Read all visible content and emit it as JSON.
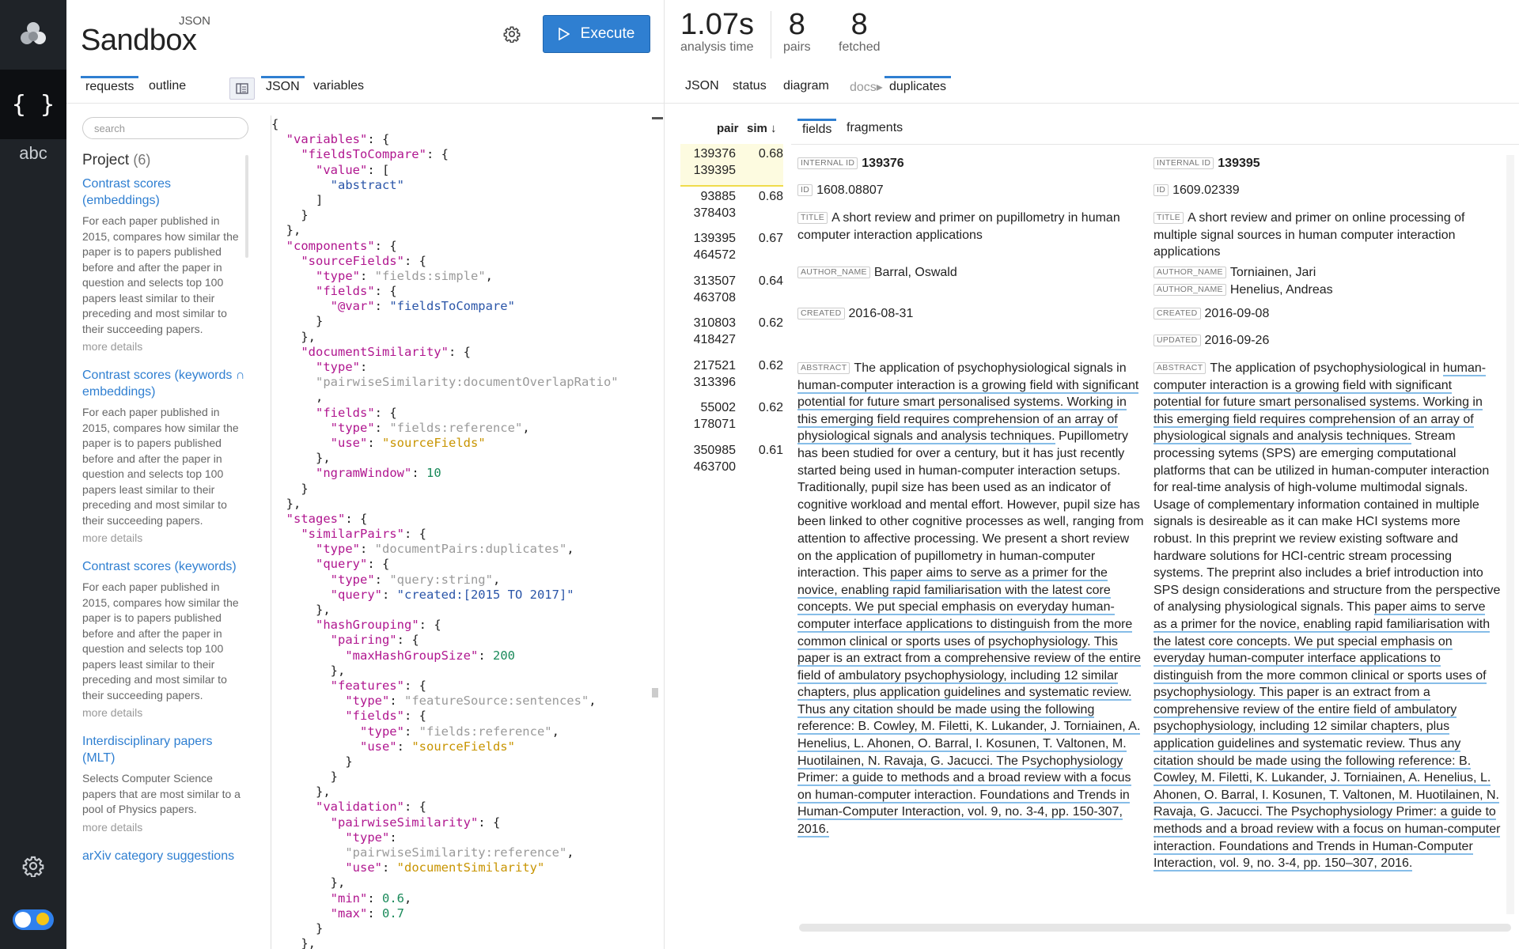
{
  "brand": {
    "sup": "JSON",
    "main": "Sandbox"
  },
  "toolbar": {
    "execute_label": "Execute"
  },
  "left_tabs": {
    "requests": "requests",
    "outline": "outline",
    "json": "JSON",
    "variables": "variables"
  },
  "search": {
    "placeholder": "search"
  },
  "project": {
    "label": "Project",
    "count": "(6)",
    "items": [
      {
        "title": "Contrast scores (embeddings)",
        "desc": "For each paper published in 2015, compares how similar the paper is to papers published before and after the paper in question and selects top 100 papers least similar to their preceding and most similar to their succeeding papers.",
        "more": "more details"
      },
      {
        "title": "Contrast scores (keywords ∩ embeddings)",
        "desc": "For each paper published in 2015, compares how similar the paper is to papers published before and after the paper in question and selects top 100 papers least similar to their preceding and most similar to their succeeding papers.",
        "more": "more details"
      },
      {
        "title": "Contrast scores (keywords)",
        "desc": "For each paper published in 2015, compares how similar the paper is to papers published before and after the paper in question and selects top 100 papers least similar to their preceding and most similar to their succeeding papers.",
        "more": "more details"
      },
      {
        "title": "Interdisciplinary papers (MLT)",
        "desc": "Selects Computer Science papers that are most similar to a pool of Physics papers.",
        "more": "more details"
      },
      {
        "title": "arXiv category suggestions",
        "desc": "",
        "more": ""
      }
    ]
  },
  "editor": {
    "lines": [
      [
        [
          "p",
          "{"
        ]
      ],
      [
        [
          "p",
          "  "
        ],
        [
          "k",
          "\"variables\""
        ],
        [
          "p",
          ": {"
        ]
      ],
      [
        [
          "p",
          "    "
        ],
        [
          "k",
          "\"fieldsToCompare\""
        ],
        [
          "p",
          ": {"
        ]
      ],
      [
        [
          "p",
          "      "
        ],
        [
          "k",
          "\"value\""
        ],
        [
          "p",
          ": ["
        ]
      ],
      [
        [
          "p",
          "        "
        ],
        [
          "sv",
          "\"abstract\""
        ]
      ],
      [
        [
          "p",
          "      ]"
        ]
      ],
      [
        [
          "p",
          "    }"
        ]
      ],
      [
        [
          "p",
          "  },"
        ]
      ],
      [
        [
          "p",
          "  "
        ],
        [
          "k",
          "\"components\""
        ],
        [
          "p",
          ": {"
        ]
      ],
      [
        [
          "p",
          "    "
        ],
        [
          "k",
          "\"sourceFields\""
        ],
        [
          "p",
          ": {"
        ]
      ],
      [
        [
          "p",
          "      "
        ],
        [
          "k",
          "\"type\""
        ],
        [
          "p",
          ": "
        ],
        [
          "st",
          "\"fields:simple\""
        ],
        [
          "p",
          ","
        ]
      ],
      [
        [
          "p",
          "      "
        ],
        [
          "k",
          "\"fields\""
        ],
        [
          "p",
          ": {"
        ]
      ],
      [
        [
          "p",
          "        "
        ],
        [
          "k",
          "\"@var\""
        ],
        [
          "p",
          ": "
        ],
        [
          "sv",
          "\"fieldsToCompare\""
        ]
      ],
      [
        [
          "p",
          "      }"
        ]
      ],
      [
        [
          "p",
          "    },"
        ]
      ],
      [
        [
          "p",
          "    "
        ],
        [
          "k",
          "\"documentSimilarity\""
        ],
        [
          "p",
          ": {"
        ]
      ],
      [
        [
          "p",
          "      "
        ],
        [
          "k",
          "\"type\""
        ],
        [
          "p",
          ":"
        ]
      ],
      [
        [
          "p",
          "      "
        ],
        [
          "st",
          "\"pairwiseSimilarity:documentOverlapRatio\""
        ]
      ],
      [
        [
          "p",
          "      ,"
        ]
      ],
      [
        [
          "p",
          "      "
        ],
        [
          "k",
          "\"fields\""
        ],
        [
          "p",
          ": {"
        ]
      ],
      [
        [
          "p",
          "        "
        ],
        [
          "k",
          "\"type\""
        ],
        [
          "p",
          ": "
        ],
        [
          "st",
          "\"fields:reference\""
        ],
        [
          "p",
          ","
        ]
      ],
      [
        [
          "p",
          "        "
        ],
        [
          "k",
          "\"use\""
        ],
        [
          "p",
          ": "
        ],
        [
          "su",
          "\"sourceFields\""
        ]
      ],
      [
        [
          "p",
          "      },"
        ]
      ],
      [
        [
          "p",
          "      "
        ],
        [
          "k",
          "\"ngramWindow\""
        ],
        [
          "p",
          ": "
        ],
        [
          "n",
          "10"
        ]
      ],
      [
        [
          "p",
          "    }"
        ]
      ],
      [
        [
          "p",
          "  },"
        ]
      ],
      [
        [
          "p",
          "  "
        ],
        [
          "k",
          "\"stages\""
        ],
        [
          "p",
          ": {"
        ]
      ],
      [
        [
          "p",
          "    "
        ],
        [
          "k",
          "\"similarPairs\""
        ],
        [
          "p",
          ": {"
        ]
      ],
      [
        [
          "p",
          "      "
        ],
        [
          "k",
          "\"type\""
        ],
        [
          "p",
          ": "
        ],
        [
          "st",
          "\"documentPairs:duplicates\""
        ],
        [
          "p",
          ","
        ]
      ],
      [
        [
          "p",
          "      "
        ],
        [
          "k",
          "\"query\""
        ],
        [
          "p",
          ": {"
        ]
      ],
      [
        [
          "p",
          "        "
        ],
        [
          "k",
          "\"type\""
        ],
        [
          "p",
          ": "
        ],
        [
          "st",
          "\"query:string\""
        ],
        [
          "p",
          ","
        ]
      ],
      [
        [
          "p",
          "        "
        ],
        [
          "k",
          "\"query\""
        ],
        [
          "p",
          ": "
        ],
        [
          "sv",
          "\"created:[2015 TO 2017]\""
        ]
      ],
      [
        [
          "p",
          "      },"
        ]
      ],
      [
        [
          "p",
          "      "
        ],
        [
          "k",
          "\"hashGrouping\""
        ],
        [
          "p",
          ": {"
        ]
      ],
      [
        [
          "p",
          "        "
        ],
        [
          "k",
          "\"pairing\""
        ],
        [
          "p",
          ": {"
        ]
      ],
      [
        [
          "p",
          "          "
        ],
        [
          "k",
          "\"maxHashGroupSize\""
        ],
        [
          "p",
          ": "
        ],
        [
          "n",
          "200"
        ]
      ],
      [
        [
          "p",
          "        },"
        ]
      ],
      [
        [
          "p",
          "        "
        ],
        [
          "k",
          "\"features\""
        ],
        [
          "p",
          ": {"
        ]
      ],
      [
        [
          "p",
          "          "
        ],
        [
          "k",
          "\"type\""
        ],
        [
          "p",
          ": "
        ],
        [
          "st",
          "\"featureSource:sentences\""
        ],
        [
          "p",
          ","
        ]
      ],
      [
        [
          "p",
          "          "
        ],
        [
          "k",
          "\"fields\""
        ],
        [
          "p",
          ": {"
        ]
      ],
      [
        [
          "p",
          "            "
        ],
        [
          "k",
          "\"type\""
        ],
        [
          "p",
          ": "
        ],
        [
          "st",
          "\"fields:reference\""
        ],
        [
          "p",
          ","
        ]
      ],
      [
        [
          "p",
          "            "
        ],
        [
          "k",
          "\"use\""
        ],
        [
          "p",
          ": "
        ],
        [
          "su",
          "\"sourceFields\""
        ]
      ],
      [
        [
          "p",
          "          }"
        ]
      ],
      [
        [
          "p",
          "        }"
        ]
      ],
      [
        [
          "p",
          "      },"
        ]
      ],
      [
        [
          "p",
          "      "
        ],
        [
          "k",
          "\"validation\""
        ],
        [
          "p",
          ": {"
        ]
      ],
      [
        [
          "p",
          "        "
        ],
        [
          "k",
          "\"pairwiseSimilarity\""
        ],
        [
          "p",
          ": {"
        ]
      ],
      [
        [
          "p",
          "          "
        ],
        [
          "k",
          "\"type\""
        ],
        [
          "p",
          ":"
        ]
      ],
      [
        [
          "p",
          "          "
        ],
        [
          "st",
          "\"pairwiseSimilarity:reference\""
        ],
        [
          "p",
          ","
        ]
      ],
      [
        [
          "p",
          "          "
        ],
        [
          "k",
          "\"use\""
        ],
        [
          "p",
          ": "
        ],
        [
          "su",
          "\"documentSimilarity\""
        ]
      ],
      [
        [
          "p",
          "        },"
        ]
      ],
      [
        [
          "p",
          "        "
        ],
        [
          "k",
          "\"min\""
        ],
        [
          "p",
          ": "
        ],
        [
          "n",
          "0.6"
        ],
        [
          "p",
          ","
        ]
      ],
      [
        [
          "p",
          "        "
        ],
        [
          "k",
          "\"max\""
        ],
        [
          "p",
          ": "
        ],
        [
          "n",
          "0.7"
        ]
      ],
      [
        [
          "p",
          "      }"
        ]
      ],
      [
        [
          "p",
          "    },"
        ]
      ]
    ]
  },
  "stats": {
    "time": {
      "value": "1.07s",
      "label": "analysis time"
    },
    "pairs": {
      "value": "8",
      "label": "pairs"
    },
    "fetched": {
      "value": "8",
      "label": "fetched"
    }
  },
  "right_tabs": {
    "json": "JSON",
    "status": "status",
    "diagram": "diagram",
    "docs": "docs▸",
    "duplicates": "duplicates"
  },
  "pairs_table": {
    "headers": {
      "pair": "pair",
      "sim": "sim ↓"
    },
    "rows": [
      {
        "a": "139376",
        "b": "139395",
        "sim": "0.68"
      },
      {
        "a": "93885",
        "b": "378403",
        "sim": "0.68"
      },
      {
        "a": "139395",
        "b": "464572",
        "sim": "0.67"
      },
      {
        "a": "313507",
        "b": "463708",
        "sim": "0.64"
      },
      {
        "a": "310803",
        "b": "418427",
        "sim": "0.62"
      },
      {
        "a": "217521",
        "b": "313396",
        "sim": "0.62"
      },
      {
        "a": "55002",
        "b": "178071",
        "sim": "0.62"
      },
      {
        "a": "350985",
        "b": "463700",
        "sim": "0.61"
      }
    ]
  },
  "sub_tabs": {
    "fields": "fields",
    "fragments": "fragments"
  },
  "labels": {
    "internal_id": "INTERNAL ID",
    "id": "ID",
    "title": "TITLE",
    "author_name": "AUTHOR_NAME",
    "created": "CREATED",
    "updated": "UPDATED",
    "abstract": "ABSTRACT"
  },
  "doc_left": {
    "internal_id": "139376",
    "id": "1608.08807",
    "title": "A short review and primer on pupillometry in human computer interaction applications",
    "authors": [
      "Barral, Oswald"
    ],
    "created": "2016-08-31",
    "abstract_segments": [
      {
        "t": "The application of psychophysiological signals in ",
        "h": false
      },
      {
        "t": "human-computer interaction is a growing field with significant potential for future smart personalised systems. Working in this emerging field requires comprehension of an array of physiological signals and analysis techniques.",
        "h": true
      },
      {
        "t": " Pupillometry has been studied for over a century, but it has just recently started being used in human-computer interaction setups. Traditionally, pupil size has been used as an indicator of cognitive workload and mental effort. However, pupil size has been linked to other cognitive processes as well, ranging from attention to affective processing. We present a short review on the application of pupillometry in human-computer interaction. This ",
        "h": false
      },
      {
        "t": "paper aims to serve as a primer for the novice, enabling rapid familiarisation with the latest core concepts. We put special emphasis on everyday human-computer interface applications to distinguish from the more common clinical or sports uses of psychophysiology. This paper is an extract from a comprehensive review of the entire field of ambulatory psychophysiology, including 12 similar chapters, plus application guidelines and systematic review. Thus any citation should be made using the following reference: B. Cowley, M. Filetti, K. Lukander, J. Torniainen, A. Henelius, L. Ahonen, O. Barral, I. Kosunen, T. Valtonen, M. Huotilainen, N. Ravaja, G. Jacucci. The Psychophysiology Primer: a guide to methods and a broad review with a focus on human-computer interaction. Foundations and Trends in Human-Computer Interaction, vol. 9, no. 3-4, pp. 150-307, 2016.",
        "h": true
      }
    ]
  },
  "doc_right": {
    "internal_id": "139395",
    "id": "1609.02339",
    "title": "A short review and primer on online processing of multiple signal sources in human computer interaction applications",
    "authors": [
      "Torniainen, Jari",
      "Henelius, Andreas"
    ],
    "created": "2016-09-08",
    "updated": "2016-09-26",
    "abstract_segments": [
      {
        "t": "The application of psychophysiological in ",
        "h": false
      },
      {
        "t": "human-computer interaction is a growing field with significant potential for future smart personalised systems. Working in this emerging field requires comprehension of an array of physiological signals and analysis techniques.",
        "h": true
      },
      {
        "t": " Stream processing sytems (SPS) are emerging computational platforms that can be utilized in human-computer interaction for real-time analysis of high-volume multimodal signals. Usage of complementary information contained in multiple signals is desireable as it can make HCI systems more robust. In this preprint we review existing software and hardware solutions for HCI-centric stream processing systems. The preprint also includes a brief introduction into SPS design considerations and structure from the perspective of analysing physiological signals. This ",
        "h": false
      },
      {
        "t": "paper aims to serve as a primer for the novice, enabling rapid familiarisation with the latest core concepts. We put special emphasis on everyday human-computer interface applications to distinguish from the more common clinical or sports uses of psychophysiology. This paper is an extract from a comprehensive review of the entire field of ambulatory psychophysiology, including 12 similar chapters, plus application guidelines and systematic review. Thus any citation should be made using the following reference: B. Cowley, M. Filetti, K. Lukander, J. Torniainen, A. Henelius, L. Ahonen, O. Barral, I. Kosunen, T. Valtonen, M. Huotilainen, N. Ravaja, G. Jacucci. The Psychophysiology Primer: a guide to methods and a broad review with a focus on human-computer interaction. Foundations and Trends in Human-Computer Interaction, vol. 9, no. 3-4, pp. 150–307, 2016.",
        "h": true
      }
    ]
  },
  "icons": {
    "logo": "app-logo-icon",
    "json": "braces-icon",
    "text": "abc-text-icon",
    "gear": "gear-icon",
    "play": "play-icon",
    "layout": "layout-icon"
  },
  "colors": {
    "accent": "#2f7fd1",
    "rail": "#1f2328",
    "highlight": "#86bde8",
    "selected_row": "#f0dc4c"
  }
}
